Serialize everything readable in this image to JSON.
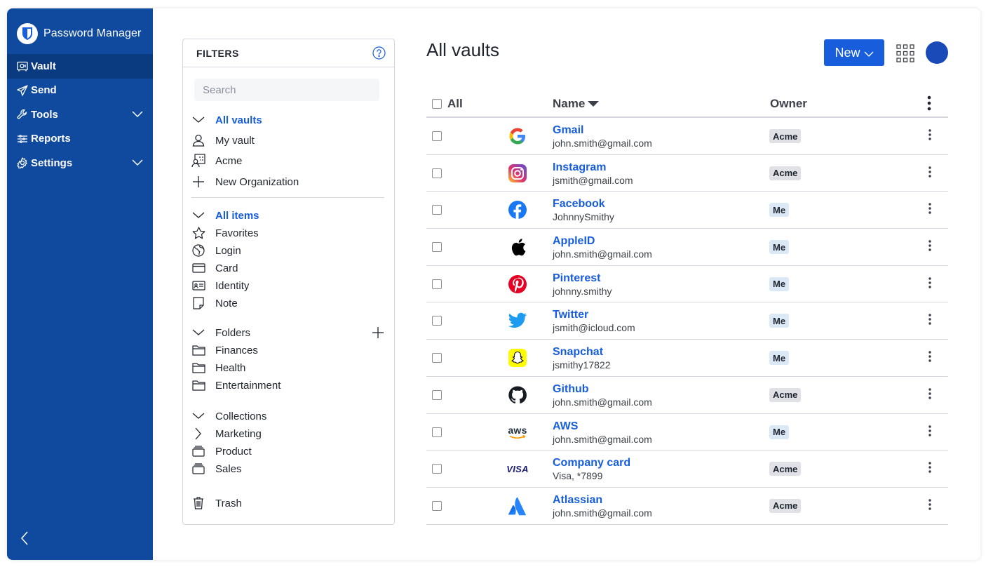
{
  "app": {
    "name": "Password Manager"
  },
  "sidebar": {
    "items": [
      {
        "label": "Vault",
        "icon": "vault-icon",
        "active": true
      },
      {
        "label": "Send",
        "icon": "send-icon"
      },
      {
        "label": "Tools",
        "icon": "wrench-icon",
        "expandable": true
      },
      {
        "label": "Reports",
        "icon": "reports-icon"
      },
      {
        "label": "Settings",
        "icon": "gear-icon",
        "expandable": true
      }
    ]
  },
  "filters": {
    "title": "FILTERS",
    "search_placeholder": "Search",
    "vaults": {
      "heading": "All vaults",
      "items": [
        "My vault",
        "Acme",
        "New Organization"
      ]
    },
    "types": {
      "heading": "All items",
      "items": [
        "Favorites",
        "Login",
        "Card",
        "Identity",
        "Note"
      ]
    },
    "folders": {
      "heading": "Folders",
      "items": [
        "Finances",
        "Health",
        "Entertainment"
      ]
    },
    "collections": {
      "heading": "Collections",
      "items": [
        "Marketing",
        "Product",
        "Sales"
      ]
    },
    "trash": "Trash"
  },
  "main": {
    "title": "All vaults",
    "new_label": "New",
    "columns": {
      "all": "All",
      "name": "Name",
      "owner": "Owner"
    },
    "rows": [
      {
        "title": "Gmail",
        "sub": "john.smith@gmail.com",
        "owner": "Acme",
        "icon": "google-logo"
      },
      {
        "title": "Instagram",
        "sub": "jsmith@gmail.com",
        "owner": "Acme",
        "icon": "instagram-logo"
      },
      {
        "title": "Facebook",
        "sub": "JohnnySmithy",
        "owner": "Me",
        "icon": "facebook-logo"
      },
      {
        "title": "AppleID",
        "sub": "john.smith@gmail.com",
        "owner": "Me",
        "icon": "apple-logo"
      },
      {
        "title": "Pinterest",
        "sub": "johnny.smithy",
        "owner": "Me",
        "icon": "pinterest-logo"
      },
      {
        "title": "Twitter",
        "sub": "jsmith@icloud.com",
        "owner": "Me",
        "icon": "twitter-logo"
      },
      {
        "title": "Snapchat",
        "sub": "jsmithy17822",
        "owner": "Me",
        "icon": "snapchat-logo"
      },
      {
        "title": "Github",
        "sub": "john.smith@gmail.com",
        "owner": "Acme",
        "icon": "github-logo"
      },
      {
        "title": "AWS",
        "sub": "john.smith@gmail.com",
        "owner": "Me",
        "icon": "aws-logo",
        "logo_text": "aws"
      },
      {
        "title": "Company card",
        "sub": "Visa, *7899",
        "owner": "Acme",
        "icon": "visa-logo",
        "logo_text": "VISA"
      },
      {
        "title": "Atlassian",
        "sub": "john.smith@gmail.com",
        "owner": "Acme",
        "icon": "atlassian-logo"
      }
    ]
  },
  "colors": {
    "sidebar": "#0f4a9e",
    "sidebar_active": "#0a3a80",
    "primary": "#175ddc",
    "avatar": "#1a49b8",
    "badge_acme": "#dfe1e6",
    "badge_me": "#dbe9f7"
  }
}
